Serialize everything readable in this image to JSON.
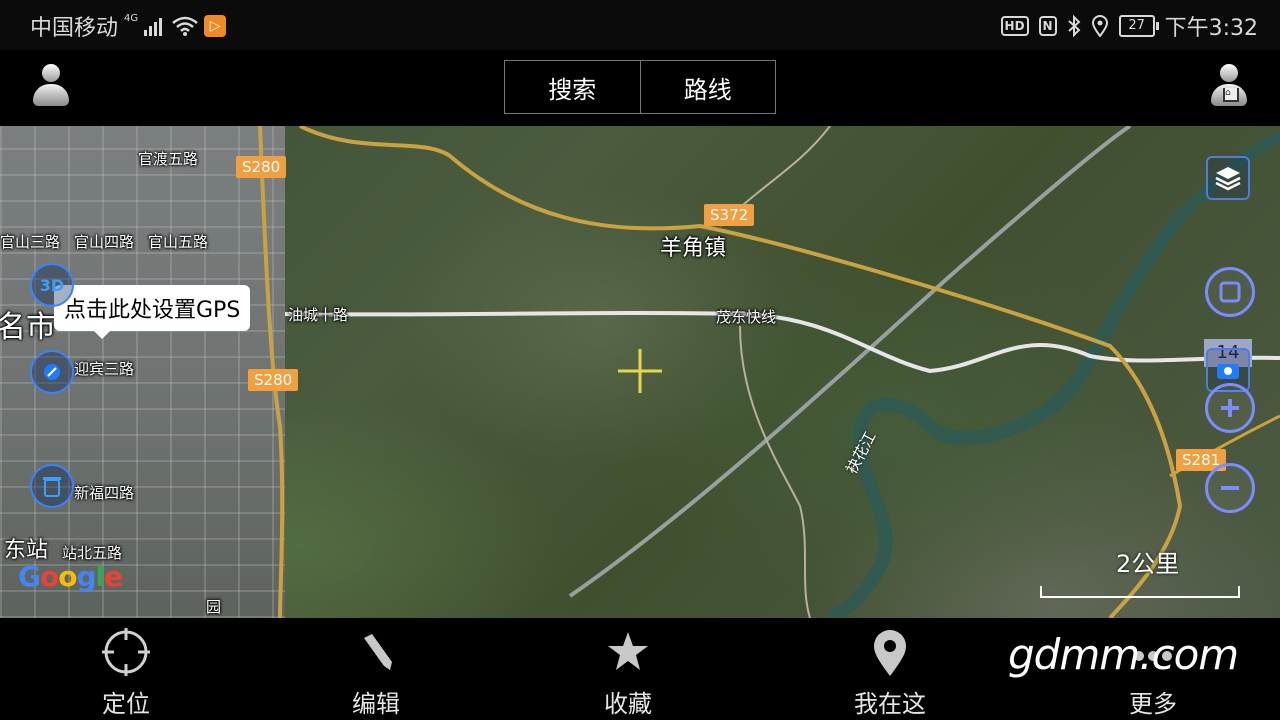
{
  "status_bar": {
    "carrier": "中国移动",
    "network": "4G",
    "hd": "HD",
    "nfc": "N",
    "battery": "27",
    "time": "下午3:32"
  },
  "toolbar": {
    "search_label": "搜索",
    "route_label": "路线"
  },
  "map": {
    "road_tags": [
      "S280",
      "S372",
      "S280",
      "S281"
    ],
    "places": {
      "guandu_5": "官渡五路",
      "guanshan_3": "官山三路",
      "guanshan_4": "官山四路",
      "guanshan_5": "官山五路",
      "city": "名市",
      "youcheng_10": "油城十路",
      "yingbin_3": "迎宾三路",
      "xinfu_4": "新福四路",
      "east_station": "东站",
      "zhanbei_5": "站北五路",
      "yangjiao": "羊角镇",
      "maodong_expressway": "茂东快线",
      "river": "袂花江",
      "small_bottom": "园"
    },
    "gps_prompt": "点击此处设置GPS",
    "label_3d": "3D",
    "zoom_level": "14",
    "scale": "2公里",
    "google_logo": "Google"
  },
  "bottom_nav": [
    {
      "label": "定位",
      "icon": "locate-icon"
    },
    {
      "label": "编辑",
      "icon": "pencil-icon"
    },
    {
      "label": "收藏",
      "icon": "star-icon"
    },
    {
      "label": "我在这",
      "icon": "location-pin-icon"
    },
    {
      "label": "更多",
      "icon": "more-icon"
    }
  ],
  "watermark": "gdmm.com",
  "colors": {
    "road_tag": "#f0a040",
    "accent_blue": "#3a82ff",
    "zoom_button": "#7a8cff",
    "crosshair": "#e6d84a"
  }
}
